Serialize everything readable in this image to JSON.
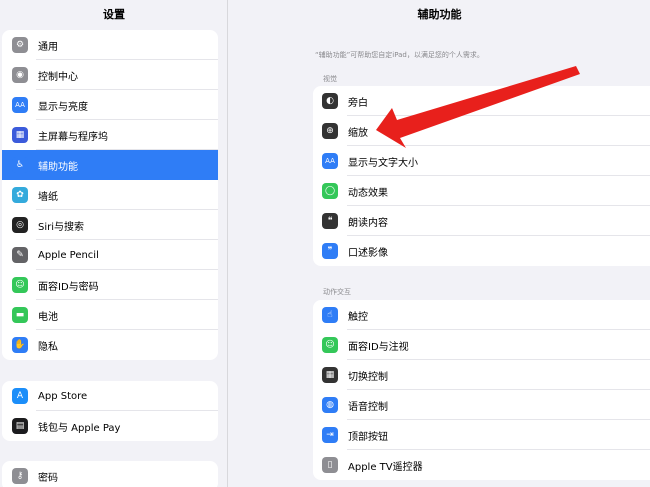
{
  "sidebar": {
    "title": "设置",
    "groups": [
      [
        {
          "label": "通用",
          "icon": "gear-icon",
          "color": "#8e8e93",
          "glyph": "⚙"
        },
        {
          "label": "控制中心",
          "icon": "toggles-icon",
          "color": "#8e8e93",
          "glyph": "◉"
        },
        {
          "label": "显示与亮度",
          "icon": "text-size-icon",
          "color": "#2f7df6",
          "glyph": "AA"
        },
        {
          "label": "主屏幕与程序坞",
          "icon": "grid-icon",
          "color": "#3b5bdb",
          "glyph": "▦"
        },
        {
          "label": "辅助功能",
          "icon": "accessibility-icon",
          "color": "#2f7df6",
          "glyph": "♿",
          "selected": true
        },
        {
          "label": "墙纸",
          "icon": "flower-icon",
          "color": "#34aadc",
          "glyph": "✿"
        },
        {
          "label": "Siri与搜索",
          "icon": "siri-icon",
          "color": "#222222",
          "glyph": "◎"
        },
        {
          "label": "Apple Pencil",
          "icon": "pencil-icon",
          "color": "#636366",
          "glyph": "✎"
        },
        {
          "label": "面容ID与密码",
          "icon": "face-id-icon",
          "color": "#34c759",
          "glyph": "☺"
        },
        {
          "label": "电池",
          "icon": "battery-icon",
          "color": "#34c759",
          "glyph": "▬"
        },
        {
          "label": "隐私",
          "icon": "hand-icon",
          "color": "#2f7df6",
          "glyph": "✋"
        }
      ],
      [
        {
          "label": "App Store",
          "icon": "app-store-icon",
          "color": "#1c8ef9",
          "glyph": "A"
        },
        {
          "label": "钱包与 Apple Pay",
          "icon": "wallet-icon",
          "color": "#1c1c1e",
          "glyph": "▤"
        }
      ],
      [
        {
          "label": "密码",
          "icon": "key-icon",
          "color": "#8e8e93",
          "glyph": "⚷"
        }
      ]
    ]
  },
  "main": {
    "title": "辅助功能",
    "description": "“辅助功能”可帮助您自定iPad，以满足您的个人需求。",
    "sections": [
      {
        "header": "视觉",
        "items": [
          {
            "label": "旁白",
            "icon": "voiceover-icon",
            "color": "#333333",
            "glyph": "◐"
          },
          {
            "label": "缩放",
            "icon": "zoom-icon",
            "color": "#333333",
            "glyph": "⊕"
          },
          {
            "label": "显示与文字大小",
            "icon": "text-size-icon",
            "color": "#2f7df6",
            "glyph": "AA"
          },
          {
            "label": "动态效果",
            "icon": "motion-icon",
            "color": "#34c759",
            "glyph": "◯"
          },
          {
            "label": "朗读内容",
            "icon": "speech-bubble-icon",
            "color": "#333333",
            "glyph": "❝"
          },
          {
            "label": "口述影像",
            "icon": "audio-description-icon",
            "color": "#2f7df6",
            "glyph": "❞"
          }
        ]
      },
      {
        "header": "动作交互",
        "items": [
          {
            "label": "触控",
            "icon": "touch-icon",
            "color": "#2f7df6",
            "glyph": "☝"
          },
          {
            "label": "面容ID与注视",
            "icon": "face-id-icon",
            "color": "#34c759",
            "glyph": "☺"
          },
          {
            "label": "切换控制",
            "icon": "switch-control-icon",
            "color": "#333333",
            "glyph": "▦"
          },
          {
            "label": "语音控制",
            "icon": "voice-control-icon",
            "color": "#2f7df6",
            "glyph": "◍"
          },
          {
            "label": "顶部按钮",
            "icon": "top-button-icon",
            "color": "#2f7df6",
            "glyph": "⇥"
          },
          {
            "label": "Apple TV遥控器",
            "icon": "remote-icon",
            "color": "#8e8e93",
            "glyph": "▯"
          }
        ]
      }
    ]
  },
  "annotation": {
    "color": "#e8201c"
  }
}
